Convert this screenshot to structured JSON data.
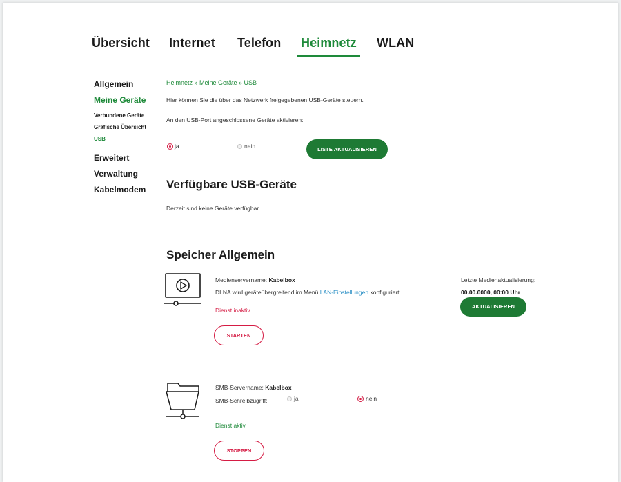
{
  "topnav": {
    "items": [
      "Übersicht",
      "Internet",
      "Telefon",
      "Heimnetz",
      "WLAN"
    ],
    "active": "Heimnetz"
  },
  "sidenav": {
    "allgemein": "Allgemein",
    "meine_geraete": "Meine Geräte",
    "verbundene": "Verbundene Geräte",
    "grafische": "Grafische Übersicht",
    "usb": "USB",
    "erweitert": "Erweitert",
    "verwaltung": "Verwaltung",
    "kabelmodem": "Kabelmodem"
  },
  "breadcrumb": "Heimnetz » Meine Geräte » USB",
  "intro": "Hier können Sie die über das Netzwerk freigegebenen USB-Geräte steuern.",
  "usb_port_label": "An den USB-Port angeschlossene Geräte aktivieren:",
  "usb_port_options": {
    "ja": "ja",
    "nein": "nein",
    "selected": "ja"
  },
  "refresh_list_button": "LISTE AKTUALISIEREN",
  "available_heading": "Verfügbare USB-Geräte",
  "available_text": "Derzeit sind keine Geräte verfügbar.",
  "storage_heading": "Speicher Allgemein",
  "media": {
    "name_label": "Medienservername:",
    "name_value": "Kabelbox",
    "dlna_prefix": "DLNA wird geräteübergreifend im Menü",
    "dlna_link": "LAN-Einstellungen",
    "dlna_suffix": "konfiguriert.",
    "status": "Dienst inaktiv",
    "start_button": "STARTEN",
    "last_update_label": "Letzte Medienaktualisierung:",
    "last_update_value": "00.00.0000, 00:00 Uhr",
    "update_button": "AKTUALISIEREN"
  },
  "smb": {
    "name_label": "SMB-Servername:",
    "name_value": "Kabelbox",
    "write_label": "SMB-Schreibzugriff:",
    "option_ja": "ja",
    "option_nein": "nein",
    "selected": "nein",
    "status": "Dienst aktiv",
    "stop_button": "STOPPEN"
  },
  "colors": {
    "brand_green": "#1e7a34",
    "accent_red": "#d51c44",
    "link_blue": "#2a8fc5"
  }
}
